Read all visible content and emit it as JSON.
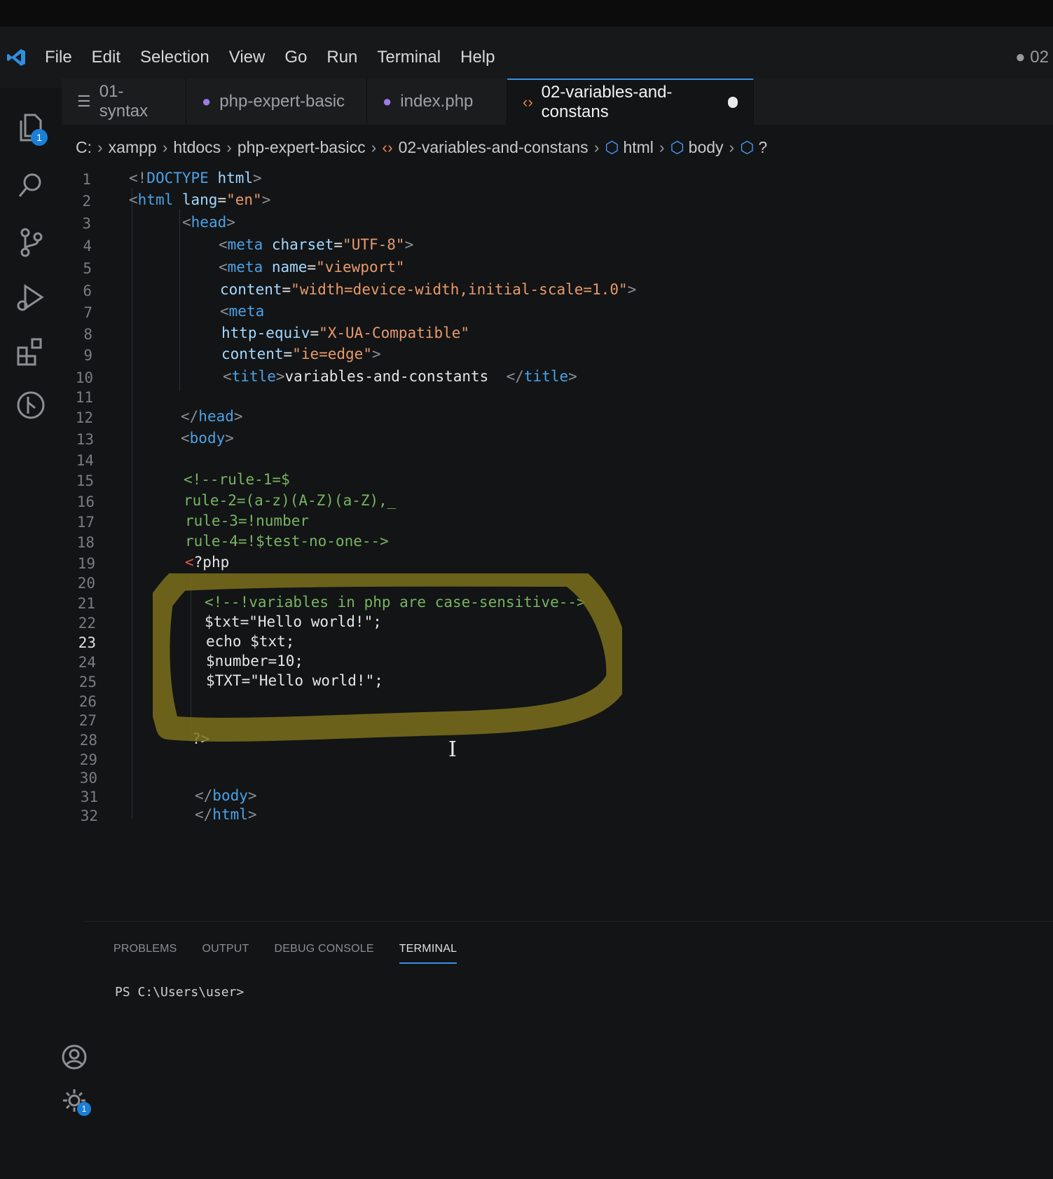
{
  "menubar": {
    "items": [
      "File",
      "Edit",
      "Selection",
      "View",
      "Go",
      "Run",
      "Terminal",
      "Help"
    ],
    "window_title": "● 02"
  },
  "activity_bar": {
    "explorer_badge": "1",
    "gear_badge": "1"
  },
  "tabs": [
    {
      "label": "01-syntax",
      "icon": "list-icon",
      "active": false
    },
    {
      "label": "php-expert-basic",
      "icon": "php-elephant-icon",
      "active": false
    },
    {
      "label": "index.php",
      "icon": "php-elephant-icon",
      "active": false
    },
    {
      "label": "02-variables-and-constans",
      "icon": "html-icon",
      "active": true,
      "modified": true
    }
  ],
  "breadcrumb": [
    "C:",
    "xampp",
    "htdocs",
    "php-expert-basicc",
    "02-variables-and-constans",
    "html",
    "body",
    "?"
  ],
  "editor": {
    "current_line": "23",
    "lines": [
      {
        "n": "1",
        "parts": [
          [
            "br",
            "<!"
          ],
          [
            "tag",
            "DOCTYPE "
          ],
          [
            "attr",
            "html"
          ],
          [
            "br",
            ">"
          ]
        ]
      },
      {
        "n": "2",
        "parts": [
          [
            "br",
            "<"
          ],
          [
            "tag",
            "html "
          ],
          [
            "attr",
            "lang"
          ],
          [
            "txt",
            "="
          ],
          [
            "str",
            "\"en\""
          ],
          [
            "br",
            ">"
          ]
        ]
      },
      {
        "n": "3",
        "parts": [
          [
            "br",
            "<"
          ],
          [
            "tag",
            "head"
          ],
          [
            "br",
            ">"
          ]
        ]
      },
      {
        "n": "4",
        "parts": [
          [
            "br",
            "<"
          ],
          [
            "tag",
            "meta "
          ],
          [
            "attr",
            "charset"
          ],
          [
            "txt",
            "="
          ],
          [
            "str",
            "\"UTF-8\""
          ],
          [
            "br",
            ">"
          ]
        ]
      },
      {
        "n": "5",
        "parts": [
          [
            "br",
            "<"
          ],
          [
            "tag",
            "meta "
          ],
          [
            "attr",
            "name"
          ],
          [
            "txt",
            "="
          ],
          [
            "str",
            "\"viewport\""
          ]
        ]
      },
      {
        "n": "6",
        "parts": [
          [
            "attr",
            "content"
          ],
          [
            "txt",
            "="
          ],
          [
            "str",
            "\"width=device-width,initial-scale=1.0\""
          ],
          [
            "br",
            ">"
          ]
        ]
      },
      {
        "n": "7",
        "parts": [
          [
            "br",
            "<"
          ],
          [
            "tag",
            "meta"
          ]
        ]
      },
      {
        "n": "8",
        "parts": [
          [
            "attr",
            "http-equiv"
          ],
          [
            "txt",
            "="
          ],
          [
            "str",
            "\"X-UA-Compatible\""
          ]
        ]
      },
      {
        "n": "9",
        "parts": [
          [
            "attr",
            "content"
          ],
          [
            "txt",
            "="
          ],
          [
            "str",
            "\"ie=edge\""
          ],
          [
            "br",
            ">"
          ]
        ]
      },
      {
        "n": "10",
        "parts": [
          [
            "br",
            "<"
          ],
          [
            "tag",
            "title"
          ],
          [
            "br",
            ">"
          ],
          [
            "txt",
            "variables-and-constants  "
          ],
          [
            "br",
            "</"
          ],
          [
            "tag",
            "title"
          ],
          [
            "br",
            ">"
          ]
        ]
      },
      {
        "n": "11",
        "parts": []
      },
      {
        "n": "12",
        "parts": [
          [
            "br",
            "</"
          ],
          [
            "tag",
            "head"
          ],
          [
            "br",
            ">"
          ]
        ]
      },
      {
        "n": "13",
        "parts": [
          [
            "br",
            "<"
          ],
          [
            "tag",
            "body"
          ],
          [
            "br",
            ">"
          ]
        ]
      },
      {
        "n": "14",
        "parts": []
      },
      {
        "n": "15",
        "parts": [
          [
            "com",
            "<!--rule-1=$"
          ]
        ]
      },
      {
        "n": "16",
        "parts": [
          [
            "com",
            "rule-2=(a-z)(A-Z)(a-Z),_"
          ]
        ]
      },
      {
        "n": "17",
        "parts": [
          [
            "com",
            "rule-3=!number"
          ]
        ]
      },
      {
        "n": "18",
        "parts": [
          [
            "com",
            "rule-4=!$test-no-one-->"
          ]
        ]
      },
      {
        "n": "19",
        "parts": [
          [
            "phpbr",
            "<"
          ],
          [
            "php",
            "?php"
          ]
        ]
      },
      {
        "n": "20",
        "parts": []
      },
      {
        "n": "21",
        "parts": [
          [
            "com",
            "<!--!variables in php are case-sensitive-->"
          ]
        ]
      },
      {
        "n": "22",
        "parts": [
          [
            "php",
            "$txt=\"Hello world!\";"
          ]
        ]
      },
      {
        "n": "23",
        "parts": [
          [
            "php",
            "echo $txt;"
          ]
        ]
      },
      {
        "n": "24",
        "parts": [
          [
            "php",
            "$number=10;"
          ]
        ]
      },
      {
        "n": "25",
        "parts": [
          [
            "php",
            "$TXT=\"Hello world!\";"
          ]
        ]
      },
      {
        "n": "26",
        "parts": []
      },
      {
        "n": "27",
        "parts": []
      },
      {
        "n": "28",
        "parts": [
          [
            "php",
            "?>"
          ]
        ]
      },
      {
        "n": "29",
        "parts": []
      },
      {
        "n": "30",
        "parts": []
      },
      {
        "n": "31",
        "parts": [
          [
            "br",
            "</"
          ],
          [
            "tag",
            "body"
          ],
          [
            "br",
            ">"
          ]
        ]
      },
      {
        "n": "32",
        "parts": [
          [
            "br",
            "</"
          ],
          [
            "tag",
            "html"
          ],
          [
            "br",
            ">"
          ]
        ]
      }
    ]
  },
  "panel": {
    "tabs": [
      "PROBLEMS",
      "OUTPUT",
      "DEBUG CONSOLE",
      "TERMINAL"
    ],
    "active_tab": "TERMINAL",
    "terminal_prompt": "PS C:\\Users\\user>"
  },
  "colors": {
    "accent": "#3a8ee6",
    "highlight_marker": "#8a7a1e"
  }
}
